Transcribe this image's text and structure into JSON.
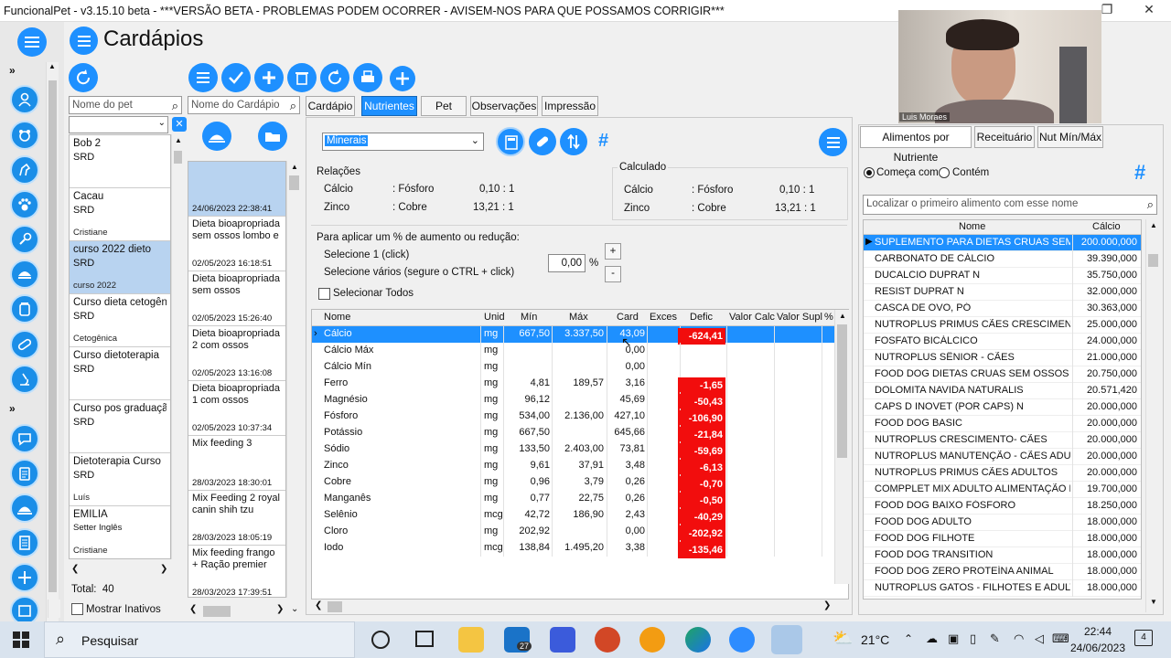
{
  "app": {
    "title": "FuncionalPet - v3.15.10 beta - ***VERSÃO BETA - PROBLEMAS PODEM OCORRER - AVISEM-NOS PARA QUE POSSAMOS CORRIGIR***"
  },
  "page": {
    "title": "Cardápios"
  },
  "webcam": {
    "name": "Luis Moraes"
  },
  "pets": {
    "search_placeholder": "Nome do pet",
    "items": [
      {
        "name": "Bob 2",
        "kind": "SRD",
        "owner": ""
      },
      {
        "name": "Cacau",
        "kind": "SRD",
        "owner": "Cristiane"
      },
      {
        "name": "curso 2022 dieto",
        "kind": "SRD",
        "owner": "curso 2022"
      },
      {
        "name": "Curso dieta cetogênica",
        "kind": "SRD",
        "owner": "Cetogênica"
      },
      {
        "name": "Curso dietoterapia",
        "kind": "SRD",
        "owner": ""
      },
      {
        "name": "Curso pos graduação",
        "kind": "SRD",
        "owner": ""
      },
      {
        "name": "Dietoterapia Curso",
        "kind": "SRD",
        "owner": "Luís"
      },
      {
        "name": "EMÍLIA",
        "kind": "Setter Inglês",
        "owner": "Cristiane"
      }
    ],
    "total_label": "Total:",
    "total": "40",
    "show_inactive": "Mostrar Inativos"
  },
  "menus": {
    "search_placeholder": "Nome do Cardápio",
    "items": [
      {
        "name": "",
        "date": "24/06/2023 22:38:41"
      },
      {
        "name": "Dieta bioapropriada sem ossos lombo e",
        "date": "02/05/2023 16:18:51"
      },
      {
        "name": "Dieta bioapropriada sem ossos",
        "date": "02/05/2023 15:26:40"
      },
      {
        "name": "Dieta bioapropriada 2 com ossos",
        "date": "02/05/2023 13:16:08"
      },
      {
        "name": "Dieta bioapropriada 1 com ossos",
        "date": "02/05/2023 10:37:34"
      },
      {
        "name": "Mix feeding 3",
        "date": "28/03/2023 18:30:01"
      },
      {
        "name": "Mix Feeding 2 royal canin shih tzu",
        "date": "28/03/2023 18:05:19"
      },
      {
        "name": "Mix feeding frango + Ração premier",
        "date": "28/03/2023 17:39:51"
      }
    ]
  },
  "tabs": [
    "Cardápio",
    "Nutrientes",
    "Pet",
    "Observações",
    "Impressão"
  ],
  "nutrients": {
    "category": "Minerais",
    "relations_label": "Relações",
    "calculated_label": "Calculado",
    "relations": [
      {
        "a": "Cálcio",
        "b": ": Fósforo",
        "v": "0,10 : 1"
      },
      {
        "a": "Zinco",
        "b": ": Cobre",
        "v": "13,21 : 1"
      }
    ],
    "calculated": [
      {
        "a": "Cálcio",
        "b": ": Fósforo",
        "v": "0,10 : 1"
      },
      {
        "a": "Zinco",
        "b": ": Cobre",
        "v": "13,21 : 1"
      }
    ],
    "apply_label": "Para aplicar um % de aumento ou redução:",
    "select_one": "Selecione 1 (click)",
    "select_many": "Selecione vários (segure o CTRL + click)",
    "percent_value": "0,00",
    "percent_sign": "%",
    "plus": "+",
    "minus": "-",
    "select_all": "Selecionar Todos",
    "columns": [
      "Nome",
      "Unid",
      "Mín",
      "Máx",
      "Card",
      "Exces",
      "Defic",
      "Valor Calc",
      "Valor Supl",
      "%"
    ],
    "rows": [
      {
        "nome": "Cálcio",
        "unid": "mg",
        "min": "667,50",
        "max": "3.337,50",
        "card": "43,09",
        "exces": "",
        "defic": "-624,41"
      },
      {
        "nome": "Cálcio Máx",
        "unid": "mg",
        "min": "",
        "max": "",
        "card": "0,00",
        "exces": "",
        "defic": ""
      },
      {
        "nome": "Cálcio Mín",
        "unid": "mg",
        "min": "",
        "max": "",
        "card": "0,00",
        "exces": "",
        "defic": ""
      },
      {
        "nome": "Ferro",
        "unid": "mg",
        "min": "4,81",
        "max": "189,57",
        "card": "3,16",
        "exces": "",
        "defic": "-1,65"
      },
      {
        "nome": "Magnésio",
        "unid": "mg",
        "min": "96,12",
        "max": "",
        "card": "45,69",
        "exces": "",
        "defic": "-50,43"
      },
      {
        "nome": "Fósforo",
        "unid": "mg",
        "min": "534,00",
        "max": "2.136,00",
        "card": "427,10",
        "exces": "",
        "defic": "-106,90"
      },
      {
        "nome": "Potássio",
        "unid": "mg",
        "min": "667,50",
        "max": "",
        "card": "645,66",
        "exces": "",
        "defic": "-21,84"
      },
      {
        "nome": "Sódio",
        "unid": "mg",
        "min": "133,50",
        "max": "2.403,00",
        "card": "73,81",
        "exces": "",
        "defic": "-59,69"
      },
      {
        "nome": "Zinco",
        "unid": "mg",
        "min": "9,61",
        "max": "37,91",
        "card": "3,48",
        "exces": "",
        "defic": "-6,13"
      },
      {
        "nome": "Cobre",
        "unid": "mg",
        "min": "0,96",
        "max": "3,79",
        "card": "0,26",
        "exces": "",
        "defic": "-0,70"
      },
      {
        "nome": "Manganês",
        "unid": "mg",
        "min": "0,77",
        "max": "22,75",
        "card": "0,26",
        "exces": "",
        "defic": "-0,50"
      },
      {
        "nome": "Selênio",
        "unid": "mcg",
        "min": "42,72",
        "max": "186,90",
        "card": "2,43",
        "exces": "",
        "defic": "-40,29"
      },
      {
        "nome": "Cloro",
        "unid": "mg",
        "min": "202,92",
        "max": "",
        "card": "0,00",
        "exces": "",
        "defic": "-202,92"
      },
      {
        "nome": "Iodo",
        "unid": "mcg",
        "min": "138,84",
        "max": "1.495,20",
        "card": "3,38",
        "exces": "",
        "defic": "-135,46"
      }
    ]
  },
  "right": {
    "tabs": [
      "Alimentos por Nutriente",
      "Receituário",
      "Nut Mín/Máx"
    ],
    "radio_starts": "Começa com",
    "radio_contains": "Contém",
    "search_placeholder": "Localizar o primeiro alimento com esse nome",
    "columns": [
      "Nome",
      "Cálcio"
    ],
    "foods": [
      {
        "n": "SUPLEMENTO PARA DIETAS CRUAS SEM OSSOS",
        "v": "200.000,000"
      },
      {
        "n": "CARBONATO DE CÁLCIO",
        "v": "39.390,000"
      },
      {
        "n": "DUCALCIO DUPRAT N",
        "v": "35.750,000"
      },
      {
        "n": "RESIST DUPRAT N",
        "v": "32.000,000"
      },
      {
        "n": "CASCA DE OVO, PÓ",
        "v": "30.363,000"
      },
      {
        "n": "NUTROPLUS PRIMUS  CÃES CRESCIMENTO",
        "v": "25.000,000"
      },
      {
        "n": "FOSFATO BICÁLCICO",
        "v": "24.000,000"
      },
      {
        "n": "NUTROPLUS SÊNIOR - CÃES",
        "v": "21.000,000"
      },
      {
        "n": "FOOD DOG DIETAS CRUAS SEM OSSOS",
        "v": "20.750,000"
      },
      {
        "n": "DOLOMITA NAVIDA NATURALIS",
        "v": "20.571,420"
      },
      {
        "n": "CAPS D INOVET (POR CAPS) N",
        "v": "20.000,000"
      },
      {
        "n": "FOOD DOG BASIC",
        "v": "20.000,000"
      },
      {
        "n": "NUTROPLUS CRESCIMENTO- CÃES",
        "v": "20.000,000"
      },
      {
        "n": "NUTROPLUS MANUTENÇÃO - CÃES ADULTOS",
        "v": "20.000,000"
      },
      {
        "n": "NUTROPLUS PRIMUS CÃES ADULTOS",
        "v": "20.000,000"
      },
      {
        "n": "COMPPLET MIX ADULTO ALIMENTAÇÃO NATURAL",
        "v": "19.700,000"
      },
      {
        "n": "FOOD DOG BAIXO FÓSFORO",
        "v": "18.250,000"
      },
      {
        "n": "FOOD DOG ADULTO",
        "v": "18.000,000"
      },
      {
        "n": "FOOD DOG FILHOTE",
        "v": "18.000,000"
      },
      {
        "n": "FOOD DOG TRANSITION",
        "v": "18.000,000"
      },
      {
        "n": "FOOD DOG ZERO PROTEÍNA ANIMAL",
        "v": "18.000,000"
      },
      {
        "n": "NUTROPLUS GATOS - FILHOTES E ADULTOS",
        "v": "18.000,000"
      }
    ]
  },
  "taskbar": {
    "search": "Pesquisar",
    "weather": "21°C",
    "time": "22:44",
    "date": "24/06/2023",
    "mail_badge": "27",
    "notif": "4"
  }
}
